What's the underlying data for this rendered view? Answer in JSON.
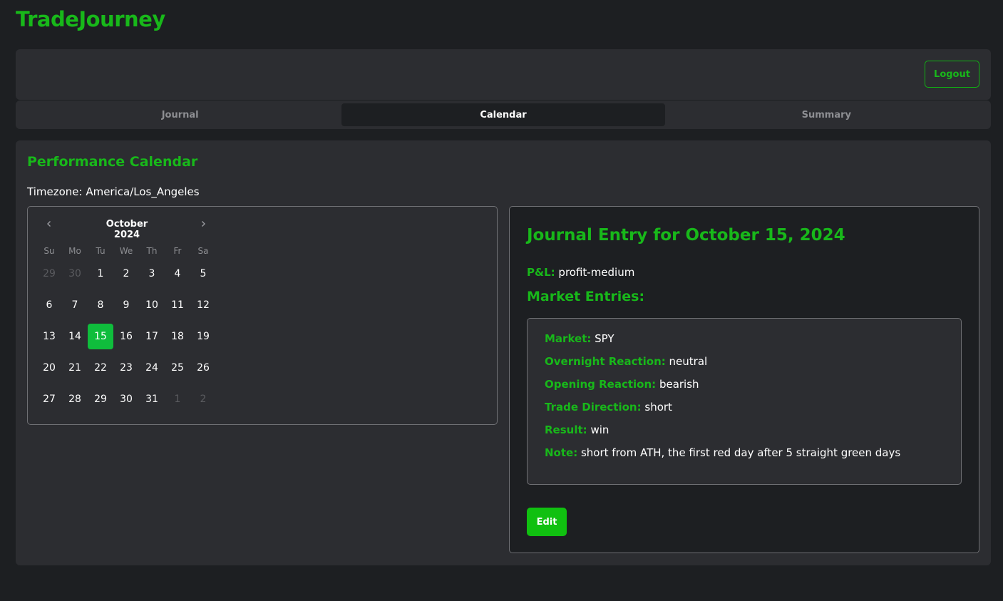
{
  "app": {
    "title": "TradeJourney"
  },
  "header": {
    "logout_label": "Logout"
  },
  "tabs": [
    {
      "label": "Journal",
      "active": false
    },
    {
      "label": "Calendar",
      "active": true
    },
    {
      "label": "Summary",
      "active": false
    }
  ],
  "calendar_section": {
    "title": "Performance Calendar",
    "timezone": "Timezone: America/Los_Angeles",
    "month_label": "October 2024",
    "weekdays": [
      "Su",
      "Mo",
      "Tu",
      "We",
      "Th",
      "Fr",
      "Sa"
    ],
    "days": [
      {
        "label": "29",
        "outside": true
      },
      {
        "label": "30",
        "outside": true
      },
      {
        "label": "1"
      },
      {
        "label": "2"
      },
      {
        "label": "3"
      },
      {
        "label": "4"
      },
      {
        "label": "5"
      },
      {
        "label": "6"
      },
      {
        "label": "7"
      },
      {
        "label": "8"
      },
      {
        "label": "9"
      },
      {
        "label": "10"
      },
      {
        "label": "11"
      },
      {
        "label": "12"
      },
      {
        "label": "13"
      },
      {
        "label": "14"
      },
      {
        "label": "15",
        "selected": true
      },
      {
        "label": "16"
      },
      {
        "label": "17"
      },
      {
        "label": "18"
      },
      {
        "label": "19"
      },
      {
        "label": "20"
      },
      {
        "label": "21"
      },
      {
        "label": "22"
      },
      {
        "label": "23"
      },
      {
        "label": "24"
      },
      {
        "label": "25"
      },
      {
        "label": "26"
      },
      {
        "label": "27"
      },
      {
        "label": "28"
      },
      {
        "label": "29"
      },
      {
        "label": "30"
      },
      {
        "label": "31"
      },
      {
        "label": "1",
        "outside": true
      },
      {
        "label": "2",
        "outside": true
      }
    ],
    "prev_icon": "chevron-left-icon",
    "next_icon": "chevron-right-icon"
  },
  "journal": {
    "title": "Journal Entry for October 15, 2024",
    "pnl_label": "P&L:",
    "pnl_value": "profit-medium",
    "market_entries_title": "Market Entries:",
    "entry": {
      "market_label": "Market:",
      "market_value": "SPY",
      "overnight_label": "Overnight Reaction:",
      "overnight_value": "neutral",
      "opening_label": "Opening Reaction:",
      "opening_value": "bearish",
      "direction_label": "Trade Direction:",
      "direction_value": "short",
      "result_label": "Result:",
      "result_value": "win",
      "note_label": "Note:",
      "note_value": "short from ATH, the first red day after 5 straight green days"
    },
    "edit_label": "Edit"
  },
  "colors": {
    "accent": "#18b81a",
    "selected_day": "#0fbd3c",
    "background": "#1d1f22",
    "panel": "#2c2d31"
  }
}
